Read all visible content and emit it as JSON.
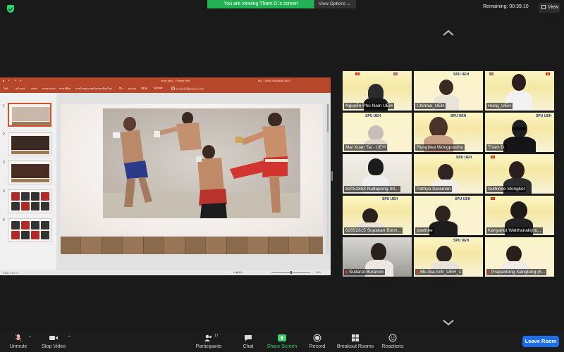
{
  "top": {
    "viewing_banner": "You are viewing Tham D.'s screen",
    "view_options": "View Options",
    "remaining_label": "Remaining: 00:39:10",
    "view_button": "View"
  },
  "ppt": {
    "document_name": "nuxtr.pptx",
    "app_name": "PowerPoint",
    "user": "Ms. THAM SAMANGAMO",
    "ribbon": [
      "ไฟล์",
      "หน้าแรก",
      "แทรก",
      "การออกแบบ",
      "การเปลี่ยน",
      "การนำเสนอภาพนิ่ง",
      "รีวิว",
      "มุมมอง",
      "วิธีใช้",
      "Acrobat"
    ],
    "tell_me": "บอกฉันสิ่งที่คุณต้องการทำ",
    "thumb_numbers": [
      "1",
      "2",
      "3",
      "4",
      "5"
    ],
    "status_left": "สไลด์ 1 จาก 5",
    "status_right": "80%"
  },
  "participants": [
    {
      "name": "Nguyễn Phú Nam UEH",
      "muted": false,
      "speaking": false
    },
    {
      "name": "Chinnie_UEH",
      "muted": false,
      "speaking": false
    },
    {
      "name": "Hung_UEH",
      "muted": false,
      "speaking": false
    },
    {
      "name": "Mai Xuan Tai - UEH",
      "muted": false,
      "speaking": false
    },
    {
      "name": "Rungtiwa Wongprasha",
      "muted": false,
      "speaking": false
    },
    {
      "name": "Tham D.",
      "muted": false,
      "speaking": true
    },
    {
      "name": "62052853 Nuttapong Sit...",
      "muted": false,
      "speaking": false
    },
    {
      "name": "Patriya Saraman",
      "muted": false,
      "speaking": false
    },
    {
      "name": "Suthinee Mongkol",
      "muted": false,
      "speaking": false
    },
    {
      "name": "62052815 Supakan Boon...",
      "muted": false,
      "speaking": false
    },
    {
      "name": "pasinee",
      "muted": false,
      "speaking": false
    },
    {
      "name": "Kanyanut Watthanakijnu...",
      "muted": false,
      "speaking": false
    },
    {
      "name": "Sudarat Buranon",
      "muted": true,
      "speaking": false
    },
    {
      "name": "Ms.Gia Anh_UEH_1",
      "muted": true,
      "speaking": false
    },
    {
      "name": "Prapantong Sangtong (6...",
      "muted": true,
      "speaking": false
    }
  ],
  "banner": {
    "title": "SPU UEH",
    "subtitle": "VIRTUAL PROGRAM - CULTURAL EXCHANGE"
  },
  "toolbar": {
    "unmute": "Unmute",
    "stop_video": "Stop Video",
    "participants": "Participants",
    "participants_count": "17",
    "chat": "Chat",
    "share_screen": "Share Screen",
    "record": "Record",
    "breakout_rooms": "Breakout Rooms",
    "reactions": "Reactions",
    "leave_room": "Leave Room"
  },
  "colors": {
    "zoom_green": "#23b154",
    "ppt_red": "#b7472a",
    "leave_blue": "#1f6feb",
    "speaking_yellow": "#d9d91f"
  }
}
